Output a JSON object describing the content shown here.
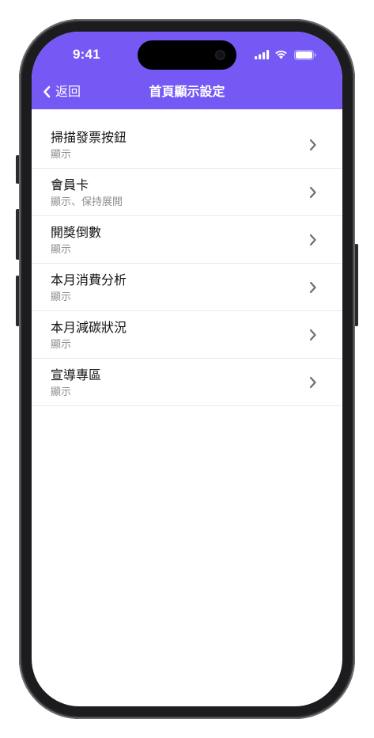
{
  "status_bar": {
    "time": "9:41",
    "icons": [
      "signal-icon",
      "wifi-icon",
      "battery-icon"
    ]
  },
  "nav": {
    "back_label": "返回",
    "back_icon": "chevron-left-icon",
    "title": "首頁顯示設定"
  },
  "colors": {
    "header_bg": "#7658f5",
    "header_text": "#ffffff",
    "subtitle": "#8e8e93",
    "chevron": "#6e6e73",
    "divider": "#e9e9ec"
  },
  "items": [
    {
      "title": "掃描發票按鈕",
      "subtitle": "顯示"
    },
    {
      "title": "會員卡",
      "subtitle": "顯示、保持展開"
    },
    {
      "title": "開獎倒數",
      "subtitle": "顯示"
    },
    {
      "title": "本月消費分析",
      "subtitle": "顯示"
    },
    {
      "title": "本月減碳狀況",
      "subtitle": "顯示"
    },
    {
      "title": "宣導專區",
      "subtitle": "顯示"
    }
  ]
}
